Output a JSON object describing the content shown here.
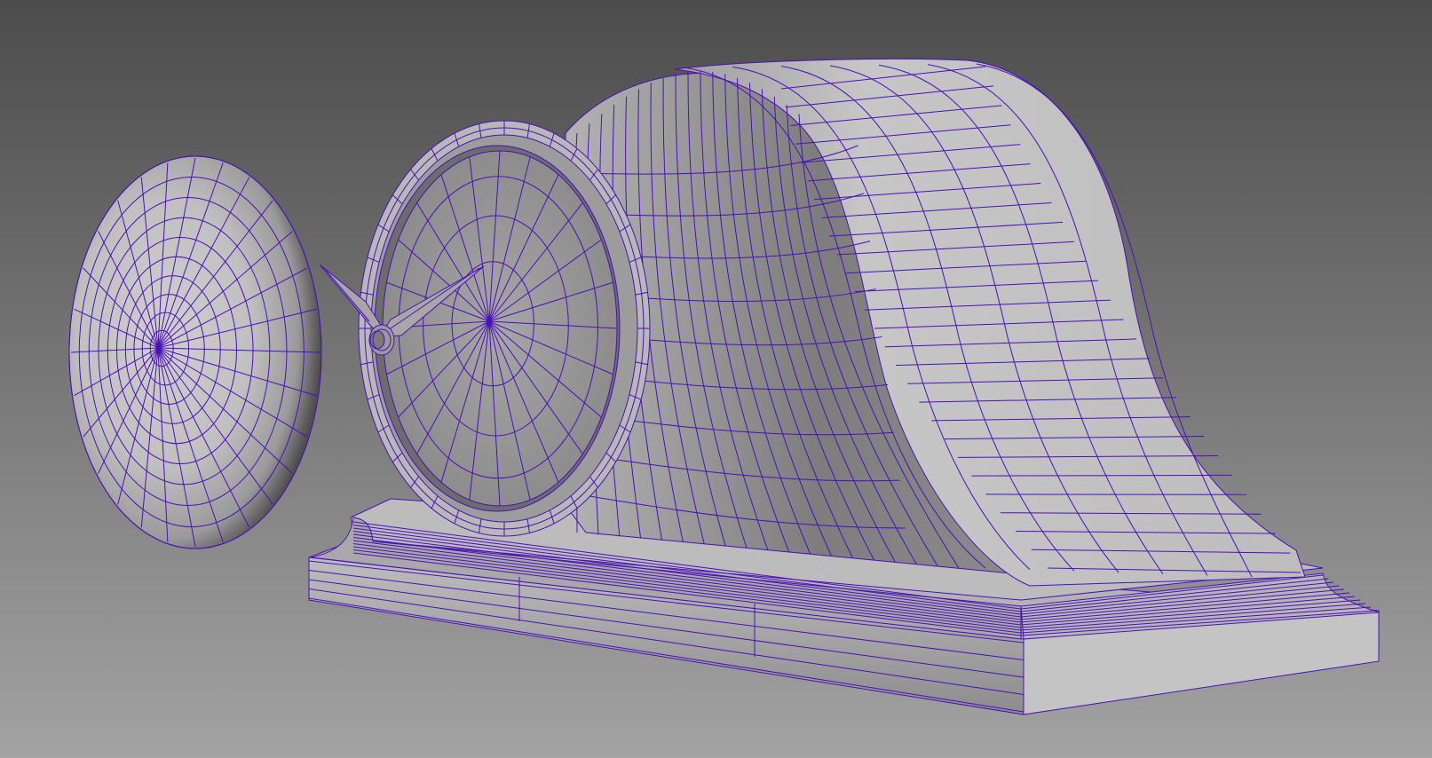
{
  "viewport": {
    "background_top": "#4c4c4c",
    "background_bottom": "#a2a2a2",
    "wire_color": "#4a10b8",
    "surface_light": "#c9c9c9",
    "surface_mid": "#a9a9a9",
    "surface_dark": "#6e6e6e"
  },
  "scene": {
    "objects": [
      "clock-case",
      "clock-base",
      "clock-bezel",
      "clock-face",
      "clock-hands",
      "dome-glass"
    ]
  }
}
